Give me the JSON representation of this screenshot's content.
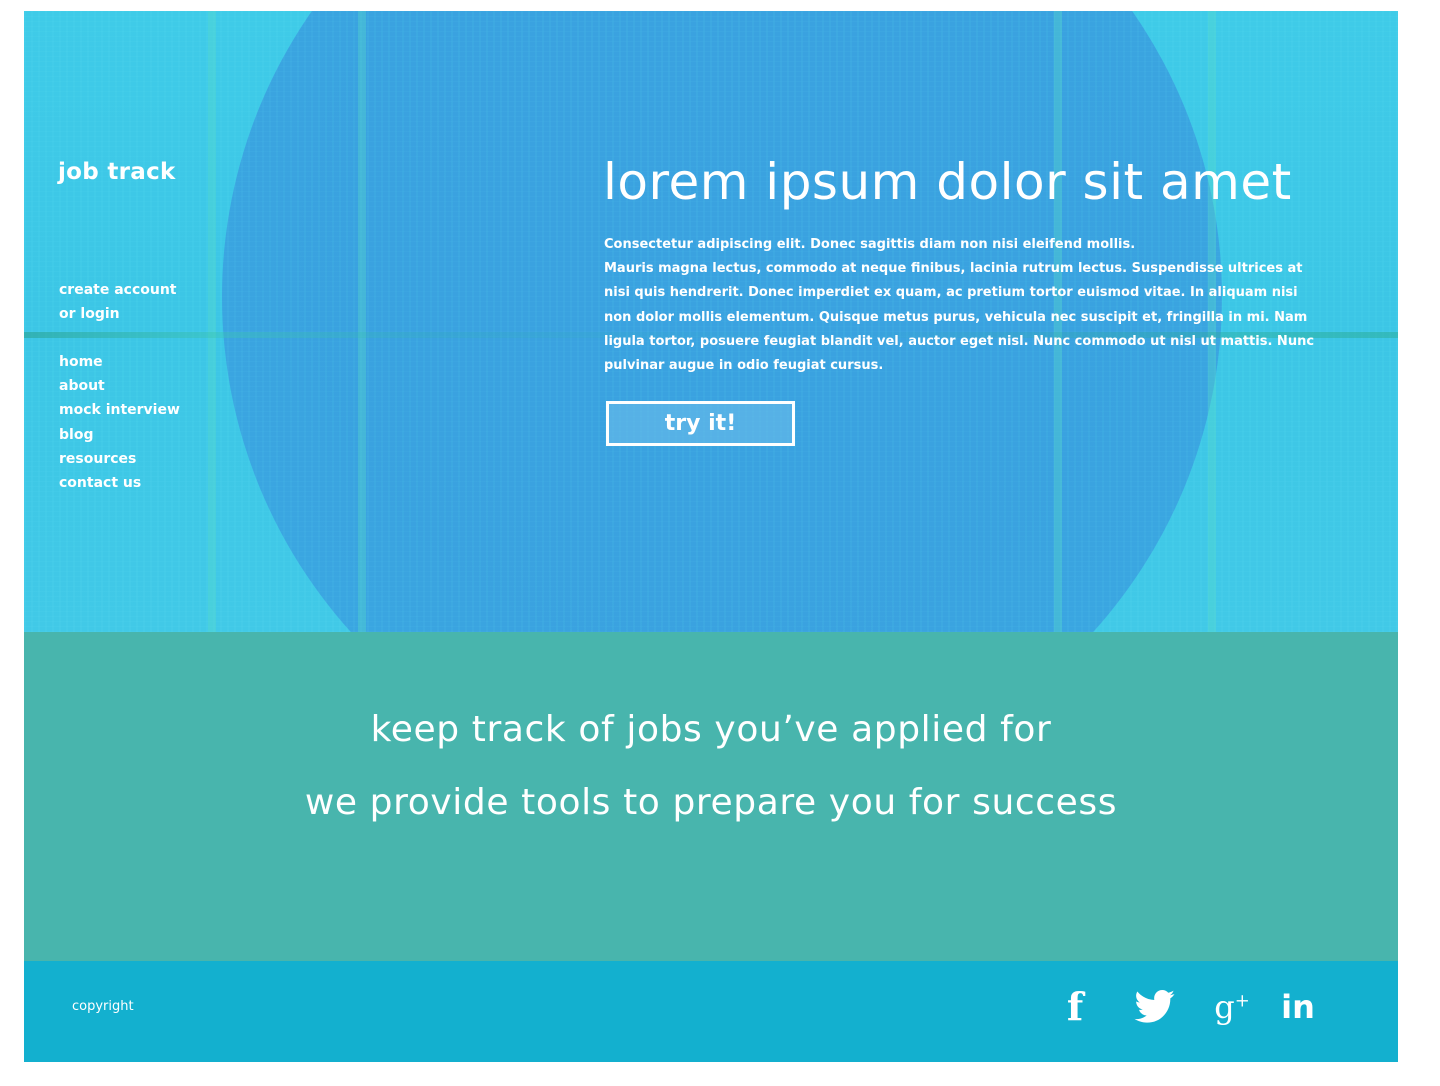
{
  "brand": {
    "logo": "job track"
  },
  "auth": {
    "line1": "create account",
    "line2": "or login"
  },
  "nav": {
    "items": [
      {
        "label": "home"
      },
      {
        "label": "about"
      },
      {
        "label": "mock interview"
      },
      {
        "label": "blog"
      },
      {
        "label": "resources"
      },
      {
        "label": "contact us"
      }
    ]
  },
  "hero": {
    "title": "lorem ipsum dolor sit amet",
    "lead": "Consectetur adipiscing elit. Donec sagittis diam non nisi eleifend mollis.",
    "body": "Mauris magna lectus, commodo at neque finibus, lacinia rutrum lectus. Suspendisse ultrices at nisi quis hendrerit. Donec imperdiet ex quam, ac pretium tortor euismod vitae. In aliquam nisi non dolor mollis elementum. Quisque metus purus, vehicula nec suscipit et, fringilla in mi. Nam ligula tortor, posuere feugiat blandit vel, auctor eget nisl. Nunc commodo ut nisl ut mattis. Nunc pulvinar augue in odio feugiat cursus.",
    "cta_label": "try it!"
  },
  "tagline": {
    "line1": "keep track of jobs you’ve applied for",
    "line2": "we provide tools to prepare you for success"
  },
  "footer": {
    "copyright": "copyright",
    "social": [
      {
        "icon": "facebook-icon"
      },
      {
        "icon": "twitter-icon"
      },
      {
        "icon": "google-plus-icon"
      },
      {
        "icon": "linkedin-icon"
      }
    ]
  },
  "colors": {
    "hero_bg": "#3fcbe8",
    "hero_circle": "#399fdf",
    "tagline_bg": "#48b5ad",
    "footer_bg": "#13b0cf",
    "text": "#ffffff"
  }
}
